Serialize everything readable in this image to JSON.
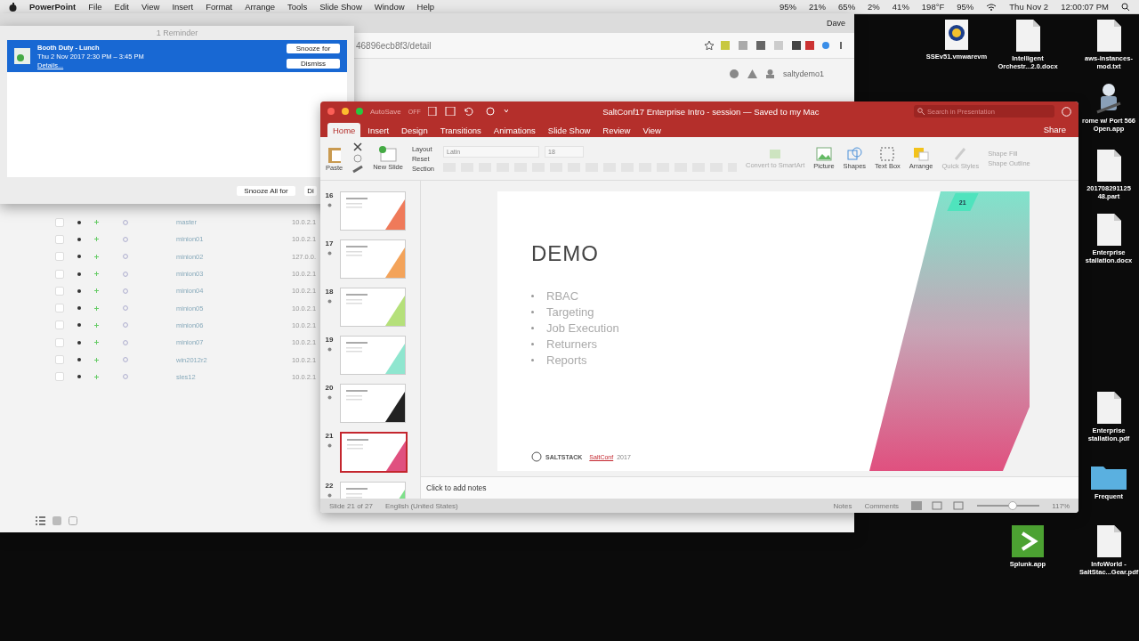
{
  "menubar": {
    "app": "PowerPoint",
    "menus": [
      "File",
      "Edit",
      "View",
      "Insert",
      "Format",
      "Arrange",
      "Tools",
      "Slide Show",
      "Window",
      "Help"
    ],
    "status": [
      "95%",
      "21%",
      "65%",
      "2%",
      "41%",
      "198°F",
      "95%"
    ],
    "date": "Thu Nov 2",
    "time": "12:00:07 PM"
  },
  "browser": {
    "user_name": "Dave",
    "url": "46896ecb8f3/detail",
    "account": "saltydemo1",
    "rows": [
      {
        "name": "master",
        "ip": "10.0.2.1",
        "checked": false
      },
      {
        "name": "minion01",
        "ip": "10.0.2.1",
        "checked": false
      },
      {
        "name": "minion02",
        "ip": "127.0.0.",
        "checked": false
      },
      {
        "name": "minion03",
        "ip": "10.0.2.1",
        "checked": false
      },
      {
        "name": "minion04",
        "ip": "10.0.2.1",
        "checked": false
      },
      {
        "name": "minion05",
        "ip": "10.0.2.1",
        "checked": false
      },
      {
        "name": "minion06",
        "ip": "10.0.2.1",
        "checked": false
      },
      {
        "name": "minion07",
        "ip": "10.0.2.1",
        "checked": false
      },
      {
        "name": "win2012r2",
        "ip": "10.0.2.1",
        "checked": false
      },
      {
        "name": "sles12",
        "ip": "10.0.2.1",
        "checked": false
      }
    ]
  },
  "reminder": {
    "title": "1 Reminder",
    "items": [
      {
        "title": "Booth Duty - Lunch",
        "time": "Thu 2 Nov 2017 2:30 PM – 3:45 PM",
        "link": "Details...",
        "selected": true
      }
    ],
    "snooze": "Snooze for",
    "dismiss": "Dismiss",
    "snooze_all": "Snooze All for",
    "dismiss_all": "Di"
  },
  "powerpoint": {
    "autosave": "AutoSave",
    "autosave_state": "OFF",
    "title": "SaltConf17 Enterprise Intro - session — Saved to my Mac",
    "search": {
      "placeholder": "Search in Presentation"
    },
    "tabs": [
      {
        "label": "Home",
        "selected": true
      },
      {
        "label": "Insert",
        "selected": false
      },
      {
        "label": "Design",
        "selected": false
      },
      {
        "label": "Transitions",
        "selected": false
      },
      {
        "label": "Animations",
        "selected": false
      },
      {
        "label": "Slide Show",
        "selected": false
      },
      {
        "label": "Review",
        "selected": false
      },
      {
        "label": "View",
        "selected": false
      }
    ],
    "share": "Share",
    "ribbon": {
      "paste": "Paste",
      "new_slide": "New Slide",
      "layout": "Layout",
      "reset": "Reset",
      "section": "Section",
      "font": "Latin",
      "size": "18",
      "smartart": "Convert to SmartArt",
      "picture": "Picture",
      "shapes": "Shapes",
      "text_box": "Text Box",
      "arrange": "Arrange",
      "quick_styles": "Quick Styles",
      "shape_fill": "Shape Fill",
      "shape_outline": "Shape Outline"
    },
    "thumbnails": [
      {
        "number": "16",
        "selected": false,
        "color": "#ef7a5a"
      },
      {
        "number": "17",
        "selected": false,
        "color": "#f3a35a"
      },
      {
        "number": "18",
        "selected": false,
        "color": "#b5e07a"
      },
      {
        "number": "19",
        "selected": false,
        "color": "#8fe6cf"
      },
      {
        "number": "20",
        "selected": false,
        "color": "#222222"
      },
      {
        "number": "21",
        "selected": true,
        "color": "#e0507f"
      },
      {
        "number": "22",
        "selected": false,
        "color": "#7ee08a"
      }
    ],
    "slide": {
      "title": "DEMO",
      "bullets": [
        "RBAC",
        "Targeting",
        "Job Execution",
        "Returners",
        "Reports"
      ],
      "number": "21",
      "logo": "SALTSTACK",
      "event": "SaltConf",
      "year": "2017"
    },
    "notes": {
      "placeholder": "Click to add notes"
    },
    "status": {
      "slide": "Slide 21 of 27",
      "language": "English (United States)",
      "notes": "Notes",
      "comments": "Comments",
      "zoom": "117%",
      "level": 0.55
    }
  },
  "desktop_icons": [
    {
      "label": "SSEv51.vmwarevm",
      "kind": "globe"
    },
    {
      "label": "Intelligent Orchestr...2.0.docx",
      "kind": "doc"
    },
    {
      "label": "aws-instances-mod.txt",
      "kind": "doc"
    },
    {
      "label": "rome w/ Port 566 Open.app",
      "kind": "app"
    },
    {
      "label": "201708291125 48.part",
      "kind": "doc"
    },
    {
      "label": "Enterprise stallation.docx",
      "kind": "doc"
    },
    {
      "label": "Enterprise stallation.pdf",
      "kind": "doc"
    },
    {
      "label": "Frequent",
      "kind": "folder"
    },
    {
      "label": "Splunk.app",
      "kind": "splunk"
    },
    {
      "label": "InfoWorld - SaltStac...Gear.pdf",
      "kind": "doc"
    }
  ]
}
